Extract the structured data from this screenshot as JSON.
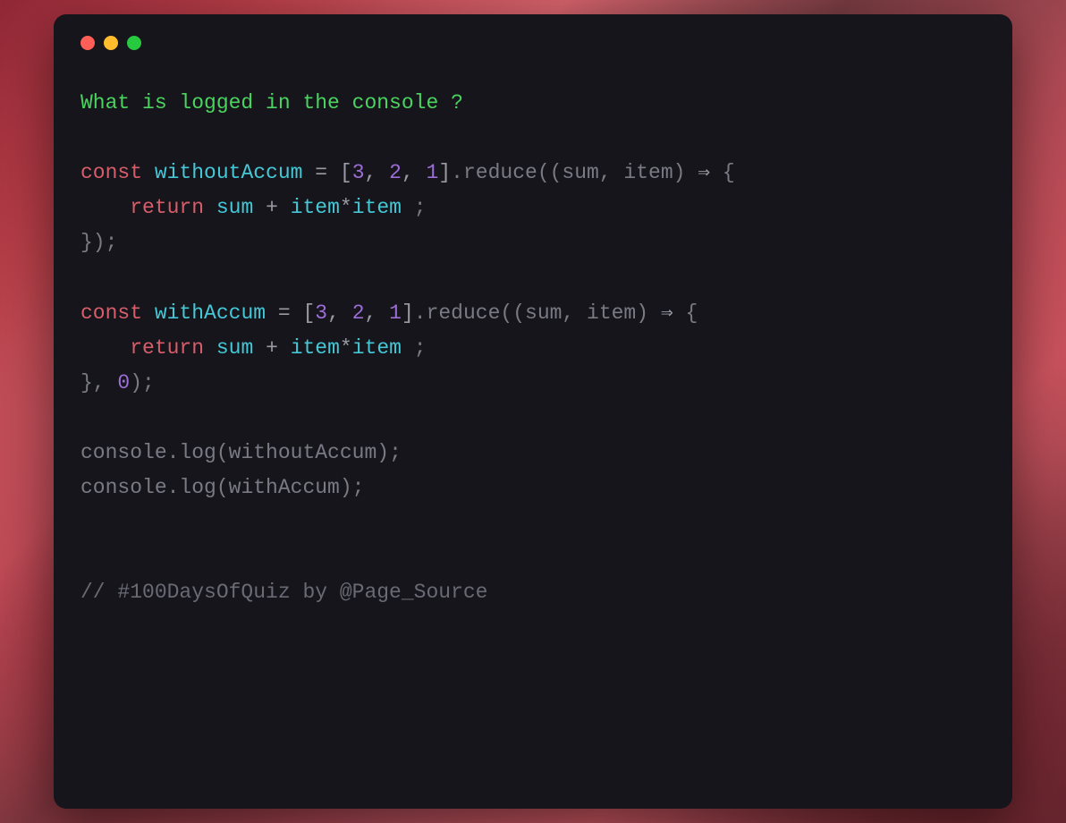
{
  "code": {
    "question": "What is logged in the console ?",
    "block1": {
      "const": "const",
      "var": "withoutAccum",
      "eq": " = ",
      "arr_open": "[",
      "n1": "3",
      "c1": ", ",
      "n2": "2",
      "c2": ", ",
      "n3": "1",
      "arr_close": "]",
      "dot": ".",
      "method": "reduce",
      "paren_open": "((sum, item) ",
      "arrow": "⇒",
      "brace_open": " {",
      "indent": "    ",
      "return": "return",
      "sp1": " ",
      "sum": "sum",
      "plus": " + ",
      "item1": "item",
      "mult": "*",
      "item2": "item",
      "semi": " ;",
      "close": "});"
    },
    "block2": {
      "const": "const",
      "var": "withAccum",
      "eq": " = ",
      "arr_open": "[",
      "n1": "3",
      "c1": ", ",
      "n2": "2",
      "c2": ", ",
      "n3": "1",
      "arr_close": "]",
      "dot": ".",
      "method": "reduce",
      "paren_open": "((sum, item) ",
      "arrow": "⇒",
      "brace_open": " {",
      "indent": "    ",
      "return": "return",
      "sp1": " ",
      "sum": "sum",
      "plus": " + ",
      "item1": "item",
      "mult": "*",
      "item2": "item",
      "semi": " ;",
      "close_pre": "}, ",
      "init": "0",
      "close_post": ");"
    },
    "log1_pre": "console.log(",
    "log1_var": "withoutAccum",
    "log1_post": ");",
    "log2_pre": "console.log(",
    "log2_var": "withAccum",
    "log2_post": ");",
    "comment": "// #100DaysOfQuiz by @Page_Source"
  }
}
